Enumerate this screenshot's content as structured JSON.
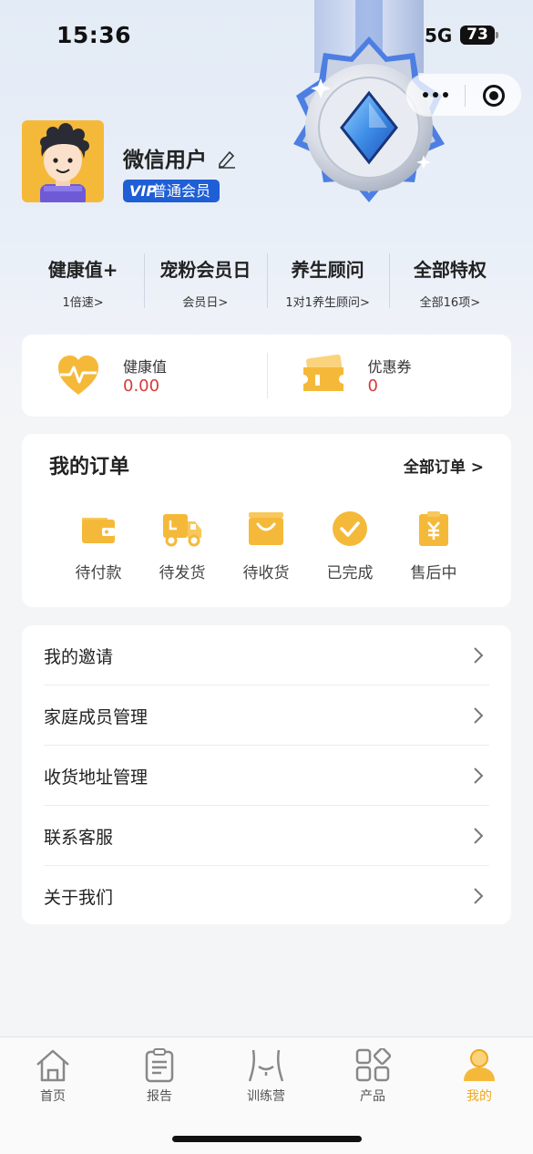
{
  "status_bar": {
    "time": "15:36",
    "network": "5G",
    "battery": "73"
  },
  "profile": {
    "username": "微信用户",
    "vip_logo": "VIP",
    "badge": "普通会员"
  },
  "privileges": [
    {
      "title": "健康值+",
      "sub": "1倍速>"
    },
    {
      "title": "宠粉会员日",
      "sub": "会员日>"
    },
    {
      "title": "养生顾问",
      "sub": "1对1养生顾问>"
    },
    {
      "title": "全部特权",
      "sub": "全部16项>"
    }
  ],
  "stats": {
    "health": {
      "label": "健康值",
      "value": "0.00",
      "icon": "heart-pulse-icon"
    },
    "coupon": {
      "label": "优惠券",
      "value": "0",
      "icon": "coupon-ticket-icon"
    }
  },
  "orders": {
    "title": "我的订单",
    "all": "全部订单 >",
    "items": [
      {
        "label": "待付款",
        "icon": "wallet-icon"
      },
      {
        "label": "待发货",
        "icon": "truck-icon"
      },
      {
        "label": "待收货",
        "icon": "shopping-bag-icon"
      },
      {
        "label": "已完成",
        "icon": "check-circle-icon"
      },
      {
        "label": "售后中",
        "icon": "receipt-yen-icon"
      }
    ]
  },
  "menu": [
    {
      "label": "我的邀请"
    },
    {
      "label": "家庭成员管理"
    },
    {
      "label": "收货地址管理"
    },
    {
      "label": "联系客服"
    },
    {
      "label": "关于我们"
    }
  ],
  "tabbar": [
    {
      "label": "首页",
      "icon": "home-icon"
    },
    {
      "label": "报告",
      "icon": "report-clipboard-icon"
    },
    {
      "label": "训练营",
      "icon": "body-torso-icon"
    },
    {
      "label": "产品",
      "icon": "product-grid-icon"
    },
    {
      "label": "我的",
      "icon": "user-profile-icon",
      "active": true
    }
  ],
  "colors": {
    "accent": "#f5b93a",
    "vip_blue": "#1f5fd6",
    "value_red": "#d83a3a",
    "active_tab": "#f0a81c"
  }
}
